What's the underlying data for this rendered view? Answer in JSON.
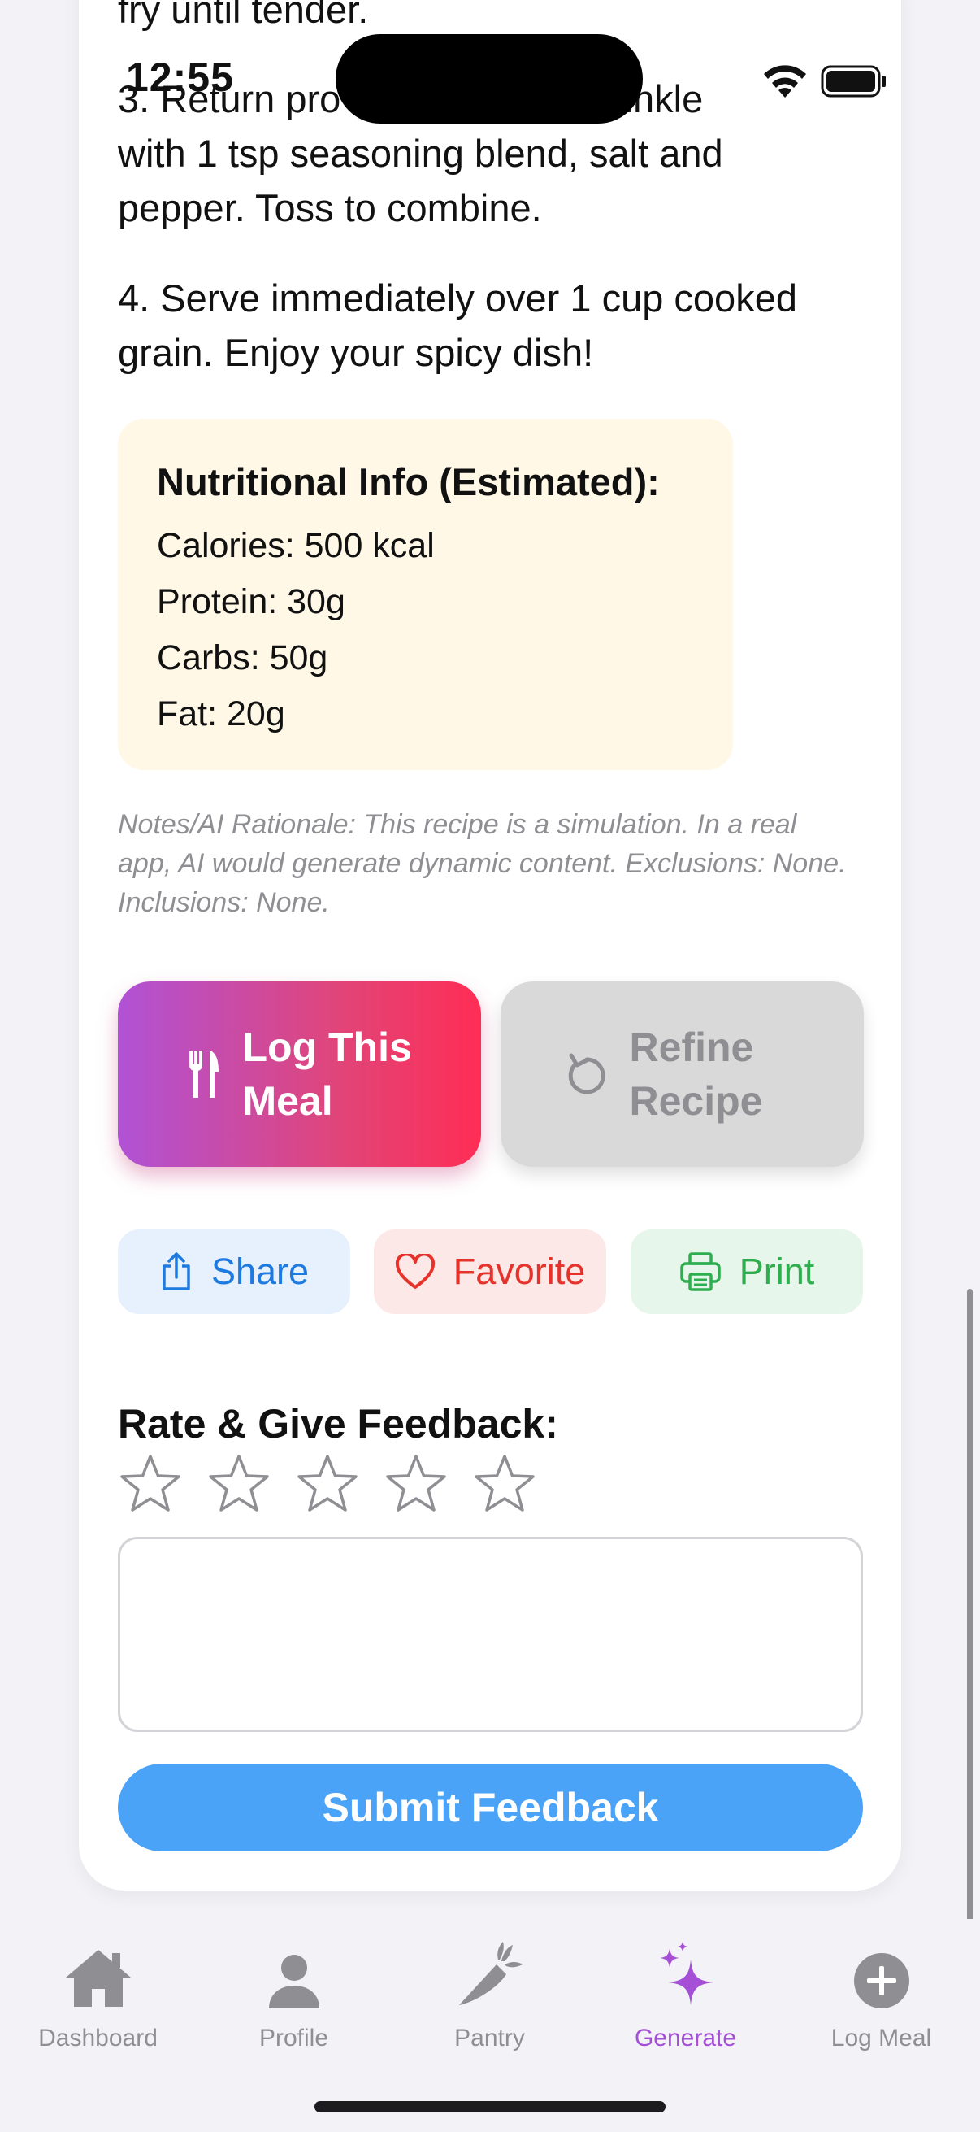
{
  "status_bar": {
    "time": "12:55"
  },
  "recipe": {
    "steps": {
      "partial_top": "fry until tender.",
      "step3": "3. Return protein to skillet. Sprinkle with 1 tsp seasoning blend, salt and pepper. Toss to combine.",
      "step3_line1": "3. Return pro",
      "step3_line1_end": ". Sprinkle",
      "step3_line2": "with 1 tsp seasoning blend, salt and",
      "step3_line3": "pepper. Toss to combine.",
      "step4_line1": "4. Serve immediately over 1 cup cooked",
      "step4_line2": "grain. Enjoy your spicy dish!"
    },
    "nutrition": {
      "title": "Nutritional Info (Estimated):",
      "calories": "Calories: 500 kcal",
      "protein": "Protein: 30g",
      "carbs": "Carbs: 50g",
      "fat": "Fat: 20g"
    },
    "notes": "Notes/AI Rationale: This recipe is a simulation. In a real app, AI would generate dynamic content. Exclusions: None. Inclusions: None."
  },
  "actions": {
    "log_label": "Log This Meal",
    "refine_label": "Refine Recipe",
    "share_label": "Share",
    "favorite_label": "Favorite",
    "print_label": "Print"
  },
  "feedback": {
    "title": "Rate & Give Feedback:",
    "rating": 0,
    "max_rating": 5,
    "text_value": "",
    "submit_label": "Submit Feedback"
  },
  "tabbar": {
    "items": [
      {
        "label": "Dashboard",
        "icon": "house-icon"
      },
      {
        "label": "Profile",
        "icon": "person-icon"
      },
      {
        "label": "Pantry",
        "icon": "carrot-icon"
      },
      {
        "label": "Generate",
        "icon": "sparkles-icon",
        "active": true
      },
      {
        "label": "Log Meal",
        "icon": "plus-circle-icon"
      }
    ]
  },
  "colors": {
    "accent_purple": "#a54fd6",
    "log_gradient_start": "#b052d6",
    "log_gradient_end": "#ff2d55",
    "submit_blue": "#4aa3f7",
    "share_blue": "#1f7ae0",
    "favorite_red": "#e5332b",
    "print_green": "#2fae4f",
    "nutrition_bg": "#fff8e6"
  }
}
